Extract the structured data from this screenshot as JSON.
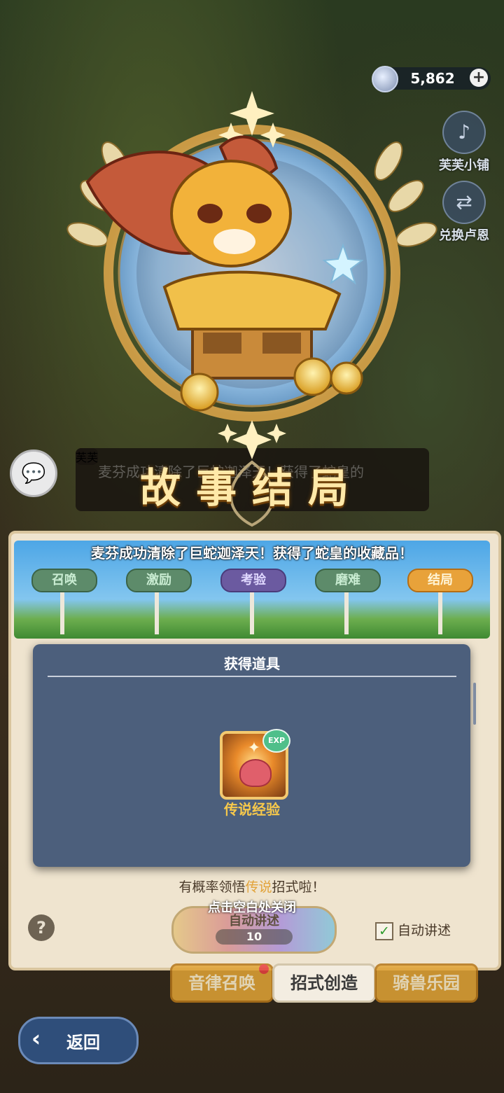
{
  "currency": {
    "amount": "5,862",
    "plus": "+",
    "icon": "gem-coin-icon"
  },
  "side_buttons": [
    {
      "label": "芙芙小铺",
      "icon": "lyre-icon"
    },
    {
      "label": "兑换卢恩",
      "icon": "exchange-icon"
    }
  ],
  "dialog": {
    "speaker": "芙芙",
    "faded_text": "麦芬成功清除了巨蛇迦泽天！获得了蛇皇的"
  },
  "emblem": {
    "title": "故事结局"
  },
  "story": {
    "sentence": "麦芬成功清除了巨蛇迦泽天！获得了蛇皇的收藏品！",
    "stages": [
      "召唤",
      "激励",
      "考验",
      "磨难",
      "结局"
    ]
  },
  "modal": {
    "title": "获得道具",
    "item": {
      "name": "传说经验",
      "badge": "EXP",
      "icon": "legend-exp-icon"
    }
  },
  "hint": {
    "prefix": "有概率领悟",
    "highlight": "传说",
    "suffix": "招式啦！"
  },
  "close_hint": "点击空白处关闭",
  "auto_narrate": {
    "label": "自动讲述",
    "cost": "10"
  },
  "help_label": "?",
  "auto_check": {
    "label": "自动讲述",
    "checked": true,
    "mark": "✓"
  },
  "tabs": [
    {
      "label": "音律召唤",
      "active": false,
      "badge": true
    },
    {
      "label": "招式创造",
      "active": true,
      "badge": false
    },
    {
      "label": "骑兽乐园",
      "active": false,
      "badge": false
    }
  ],
  "back": {
    "label": "返回",
    "arrow": "‹"
  },
  "colors": {
    "gold": "#ffe9a8",
    "modal_bg": "#4c5f7c",
    "accent_orange": "#e2a436"
  }
}
